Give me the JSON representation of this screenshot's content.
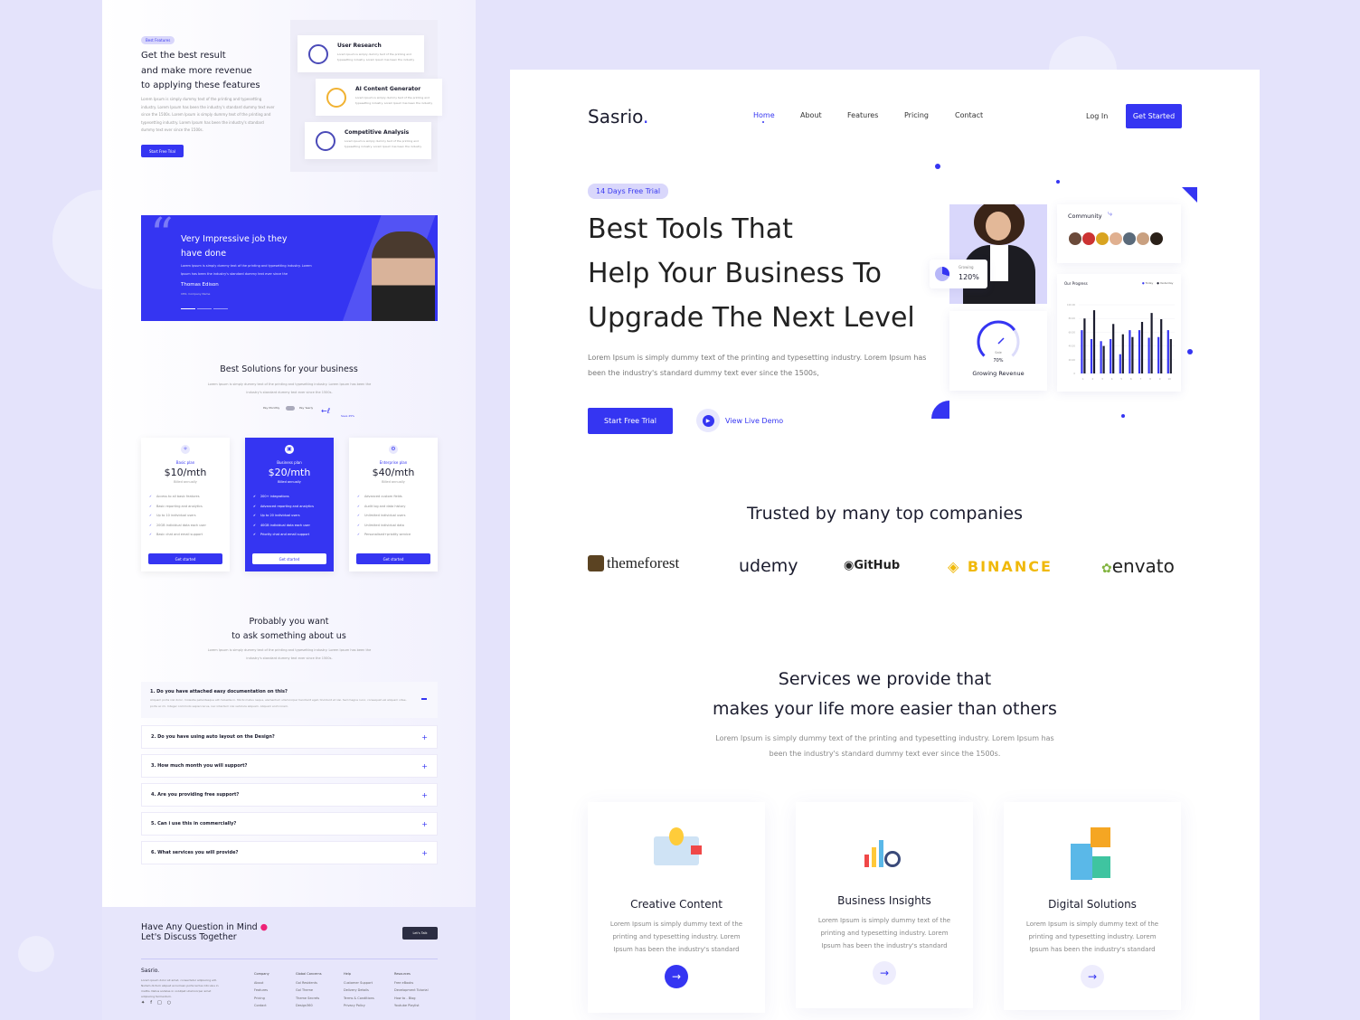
{
  "colors": {
    "accent": "#3535f2",
    "background": "#e4e3fb",
    "dark_button": "#2b2d42"
  },
  "features": {
    "badge": "Best Features",
    "title": [
      "Get the best result",
      "and make more revenue",
      "to applying these features"
    ],
    "body": "Lorem Ipsum is simply dummy text of the printing and typesetting industry. Lorem Ipsum has been the industry's standard dummy text ever since the 1500s. Lorem Ipsum is simply dummy text of the printing and typesetting industry. Lorem Ipsum has been the industry's standard dummy text ever since the 1500s.",
    "cta": "Start Free Trial",
    "items": [
      {
        "title": "User Research",
        "text": "Lorem Ipsum is simply dummy text of the printing and typesetting industry. Lorem Ipsum has been the industry",
        "icon": "user-research-icon"
      },
      {
        "title": "AI Content Generator",
        "text": "Lorem Ipsum is simply dummy text of the printing and typesetting industry. Lorem Ipsum has been the industry",
        "icon": "ai-content-icon"
      },
      {
        "title": "Competitive Analysis",
        "text": "Lorem Ipsum is simply dummy text of the printing and typesetting industry. Lorem Ipsum has been the industry",
        "icon": "competitive-analysis-icon"
      }
    ]
  },
  "testimonial": {
    "quote1": "Very Impressive job they",
    "quote2": "have done",
    "text": "Lorem Ipsum is simply dummy text of the printing and typesetting industry. Lorem Ipsum has been the industry's standard dummy text ever since the",
    "name": "Thomas Edison",
    "role": "CEO, Company Name"
  },
  "pricing": {
    "title": "Best Solutions for your business",
    "subtitle": "Lorem Ipsum is simply dummy text of the printing and typesetting industry. Lorem Ipsum has been the industry's standard dummy text ever since the 1500s.",
    "monthly": "Pay Monthly",
    "yearly": "Pay Yearly",
    "save": "Save 25%",
    "plans": [
      {
        "name": "Basic plan",
        "price": "$10/mth",
        "billing": "Billed annually",
        "features": [
          "Access to all basic features",
          "Basic reporting and analytics",
          "Up to 10 individual users",
          "20GB individual data each user",
          "Basic chat and email support"
        ],
        "cta": "Get started"
      },
      {
        "name": "Business plan",
        "price": "$20/mth",
        "billing": "Billed annually",
        "features": [
          "200+ integrations",
          "Advanced reporting and analytics",
          "Up to 20 individual users",
          "40GB individual data each user",
          "Priority chat and email support"
        ],
        "cta": "Get started"
      },
      {
        "name": "Enterprise plan",
        "price": "$40/mth",
        "billing": "Billed annually",
        "features": [
          "Advanced custom fields",
          "Audit log and data history",
          "Unlimited individual users",
          "Unlimited individual data",
          "Personalised+priotity service"
        ],
        "cta": "Get started"
      }
    ]
  },
  "faq": {
    "title1": "Probably you want",
    "title2": "to ask something about us",
    "subtitle": "Lorem Ipsum is simply dummy text of the printing and typesetting industry. Lorem Ipsum has been the industry's standard dummy text ever since the 1500s.",
    "open_answer": "Aliquam porta nisl dolor, molestie pellentesque elit molestie in. Morbi metus neque, elementum ullamcorper hendrerit eget, tincidunt et nisi. Sed magna nunc, consequat vel aliquam vitae, porta ac mi. Integer commodo sapien lacus, nec interdum nisi vehicula aliquam. Aliquam enim lorem.",
    "items": [
      "1. Do you have attached easy documentation on this?",
      "2. Do you have using auto layout on the Design?",
      "3. How much month you will support?",
      "4. Are you providing free support?",
      "5. Can i use this in commercially?",
      "6. What services you will provide?"
    ]
  },
  "footer": {
    "cta1": "Have Any Question in Mind",
    "cta2": "Let's Discuss Together",
    "button": "Let's Talk",
    "brand": "Sasrio.",
    "about": "Lorem ipsum dolor sit amet, consectetur adipiscing elit. Nullam dictum aliquet accumsan porta lectus ridiculus in mattis. Netus sodales in volutpat ullamcorper amet adipiscing fermentum.",
    "columns": [
      {
        "title": "Company",
        "links": [
          "About",
          "Features",
          "Pricing",
          "Contact"
        ]
      },
      {
        "title": "Global Concerns",
        "links": [
          "Gol Residents",
          "Gol Theme",
          "Theme Secrets",
          "Design360"
        ]
      },
      {
        "title": "Help",
        "links": [
          "Customer Support",
          "Delivery Details",
          "Terms & Conditions",
          "Privacy Policy"
        ]
      },
      {
        "title": "Resources",
        "links": [
          "Free eBooks",
          "Development Tutorial",
          "How to - Blog",
          "Youtube Playlist"
        ]
      }
    ]
  },
  "nav": {
    "brand": "Sasrio",
    "items": [
      "Home",
      "About",
      "Features",
      "Pricing",
      "Contact"
    ],
    "active": "Home",
    "login": "Log In",
    "cta": "Get Started"
  },
  "hero": {
    "badge": "14 Days Free Trial",
    "title": [
      "Best Tools That",
      "Help Your Business To",
      "Upgrade The Next Level"
    ],
    "body": "Lorem Ipsum is simply dummy text of the printing and typesetting industry. Lorem Ipsum has been the industry's standard dummy text ever since the 1500s,",
    "cta": "Start Free Trial",
    "demo": "View Live Demo",
    "growing_label": "Growing",
    "growing_value": "120%",
    "community": "Community",
    "gauge_label": "Sale",
    "gauge_value": "70%",
    "gauge_percent": 70,
    "gauge_title": "Growing Revenue",
    "progress": {
      "title": "Our Progress",
      "legend": [
        "Today",
        "Yesterday"
      ],
      "yticks": [
        "0",
        "20.00",
        "40.00",
        "60.00",
        "80.00",
        "100.00"
      ],
      "x": [
        "1",
        "2",
        "3",
        "4",
        "5",
        "6",
        "7",
        "8",
        "9",
        "10"
      ],
      "today": [
        63,
        50,
        47,
        50,
        28,
        63,
        63,
        52,
        53,
        63
      ],
      "yesterday": [
        80,
        92,
        40,
        72,
        57,
        53,
        75,
        88,
        79,
        50
      ]
    }
  },
  "trusted": {
    "title": "Trusted by many top companies",
    "logos": [
      "themeforest",
      "udemy",
      "GitHub",
      "BINANCE",
      "envato"
    ]
  },
  "services": {
    "title1": "Services we provide that",
    "title2": "makes your life more easier than others",
    "subtitle1": "Lorem Ipsum is simply dummy text of the printing and typesetting industry. Lorem Ipsum has",
    "subtitle2": "been the industry's standard dummy text ever since the 1500s.",
    "items": [
      {
        "title": "Creative Content",
        "text": "Lorem Ipsum is simply dummy text of the printing and typesetting industry. Lorem Ipsum has been the industry's standard"
      },
      {
        "title": "Business Insights",
        "text": "Lorem Ipsum is simply dummy text of the printing and typesetting industry. Lorem Ipsum has been the industry's standard"
      },
      {
        "title": "Digital Solutions",
        "text": "Lorem Ipsum is simply dummy text of the printing and typesetting industry. Lorem Ipsum has been the industry's standard"
      }
    ]
  }
}
